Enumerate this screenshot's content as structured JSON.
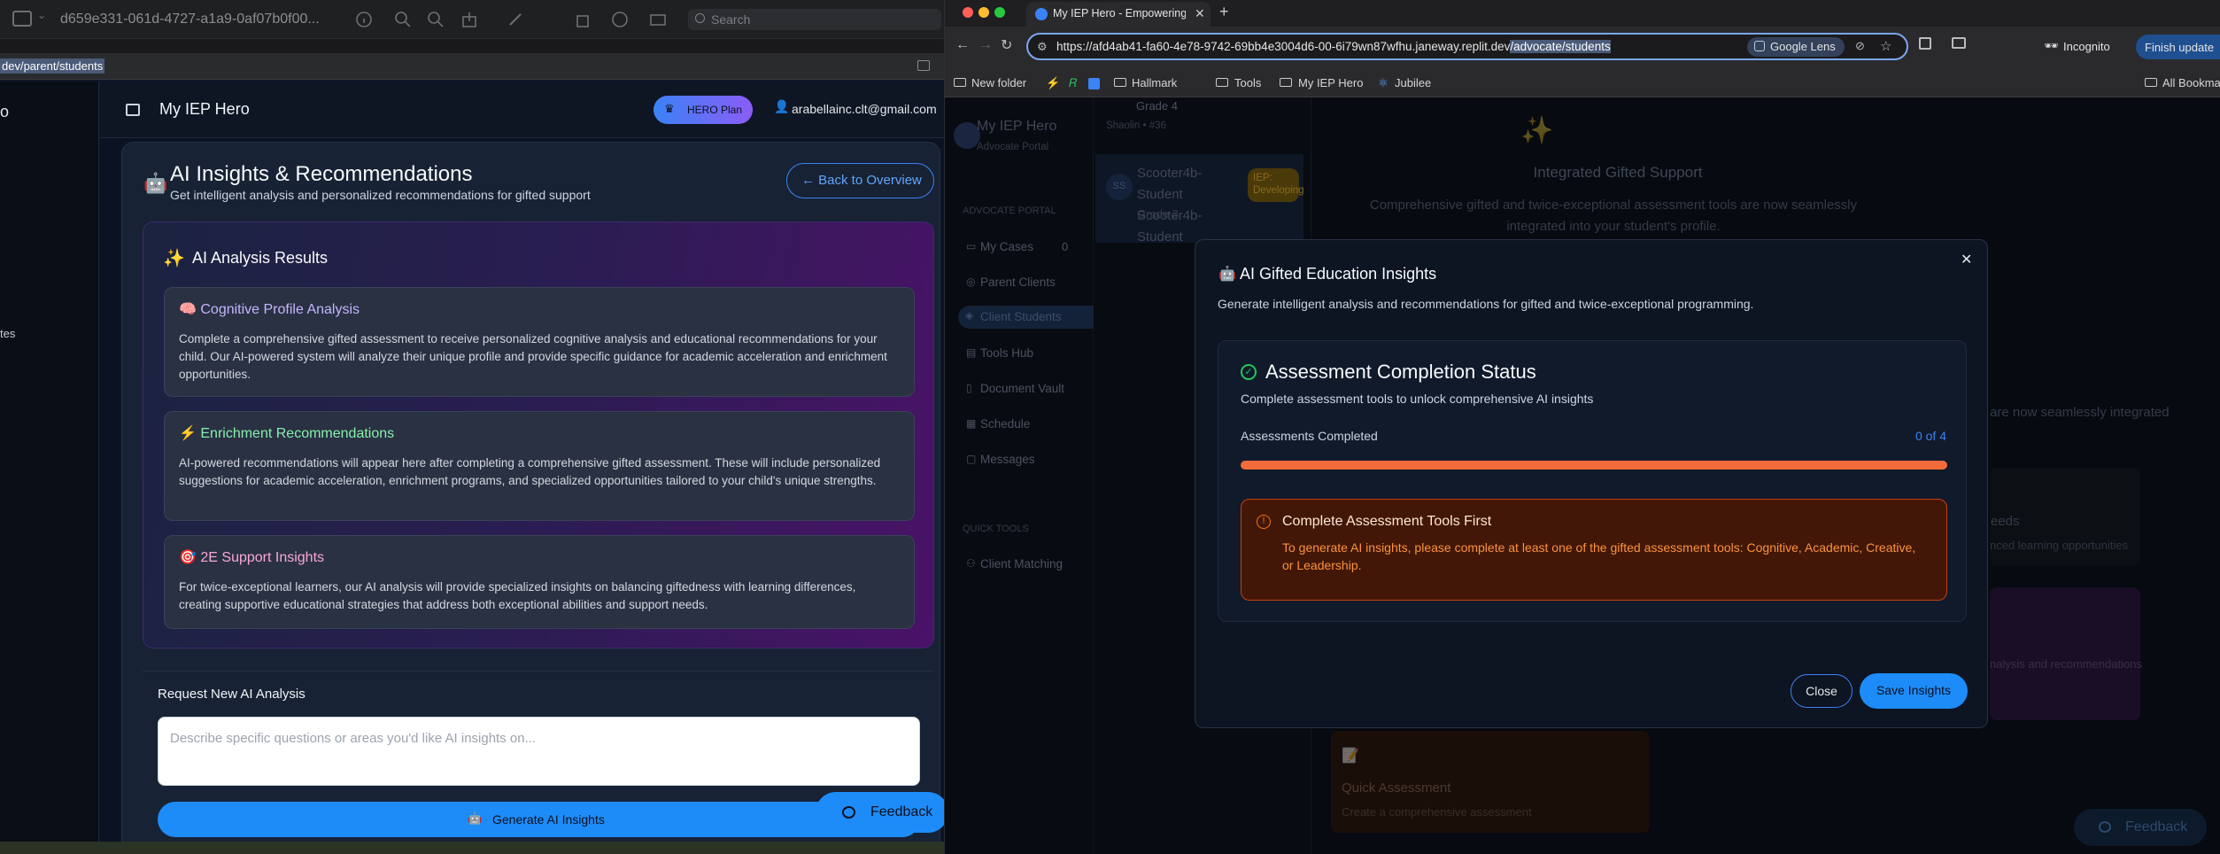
{
  "left_window": {
    "title": "d659e331-061d-4727-a1a9-0af07b0f00...",
    "search_placeholder": "Search",
    "url_selected": "dev/parent/students",
    "sidebar_fragments": [
      "o",
      "tes"
    ]
  },
  "app": {
    "brand": "My IEP Hero",
    "plan": "HERO Plan",
    "user_email": "arabellainc.clt@gmail.com",
    "page_title": "AI Insights & Recommendations",
    "page_subtitle": "Get intelligent analysis and personalized recommendations for gifted support",
    "back_button": "← Back to Overview",
    "results_heading": "AI Analysis Results",
    "results": [
      {
        "emoji": "🧠",
        "title": "Cognitive Profile Analysis",
        "body": "Complete a comprehensive gifted assessment to receive personalized cognitive analysis and educational recommendations for your child. Our AI-powered system will analyze their unique profile and provide specific guidance for academic acceleration and enrichment opportunities.",
        "color": "#c4b5fd"
      },
      {
        "emoji": "⚡",
        "title": "Enrichment Recommendations",
        "body": "AI-powered recommendations will appear here after completing a comprehensive gifted assessment. These will include personalized suggestions for academic acceleration, enrichment programs, and specialized opportunities tailored to your child's unique strengths.",
        "color": "#86efac"
      },
      {
        "emoji": "🎯",
        "title": "2E Support Insights",
        "body": "For twice-exceptional learners, our AI analysis will provide specialized insights on balancing giftedness with learning differences, creating supportive educational strategies that address both exceptional abilities and support needs.",
        "color": "#f9a8d4"
      }
    ],
    "request_heading": "Request New AI Analysis",
    "request_placeholder": "Describe specific questions or areas you'd like AI insights on...",
    "generate_button": "Generate AI Insights",
    "feedback_button": "Feedback"
  },
  "browser": {
    "tab_title": "My IEP Hero - Empowering Pa",
    "url_prefix": "https://afd4ab41-fa60-4e78-9742-69bb4e3004d6-00-6i79wn87wfhu.janeway.replit.dev",
    "url_selected": "/advocate/students",
    "google_lens": "Google Lens",
    "incognito": "Incognito",
    "finish_update": "Finish update",
    "bookmarks": [
      "New folder",
      "Hallmark",
      "Tools",
      "My IEP Hero",
      "Jubilee"
    ],
    "all_bookmarks": "All Bookmarks"
  },
  "portal": {
    "brand": "My IEP Hero",
    "brand_sub": "Advocate Portal",
    "section": "ADVOCATE PORTAL",
    "nav": [
      {
        "label": "My Cases",
        "count": "0"
      },
      {
        "label": "Parent Clients",
        "count": ""
      },
      {
        "label": "Client Students",
        "count": ""
      },
      {
        "label": "Tools Hub",
        "count": ""
      },
      {
        "label": "Document Vault",
        "count": ""
      },
      {
        "label": "Schedule",
        "count": ""
      },
      {
        "label": "Messages",
        "count": ""
      }
    ],
    "quick_tools": "QUICK TOOLS",
    "quick_nav": [
      "Client Matching"
    ],
    "students": [
      {
        "grade": "Grade 4",
        "school": "Shaolin • #36"
      },
      {
        "name": "Scooter4b-Student Scooter4b-Student",
        "grade": "Grade 3",
        "badge": "IEP: Developing",
        "initials": "SS"
      }
    ],
    "bg_panel_icon": "✨",
    "bg_panel_title": "Integrated Gifted Support",
    "bg_panel_text": "Comprehensive gifted and twice-exceptional assessment tools are now seamlessly integrated into your student's profile.",
    "bg_fragment_1": "are now seamlessly integrated",
    "bg_fragment_2": "eeds",
    "bg_fragment_3": "nced learning opportunities",
    "bg_fragment_4": "nalysis and recommendations",
    "quick_assessment_title": "Quick Assessment",
    "quick_assessment_desc": "Create a comprehensive assessment",
    "feedback": "Feedback"
  },
  "modal": {
    "title": "AI Gifted Education Insights",
    "subtitle": "Generate intelligent analysis and recommendations for gifted and twice-exceptional programming.",
    "status_title": "Assessment Completion Status",
    "status_sub": "Complete assessment tools to unlock comprehensive AI insights",
    "progress_label": "Assessments Completed",
    "progress_value": "0 of 4",
    "progress_fraction": 0,
    "warn_title": "Complete Assessment Tools First",
    "warn_body": "To generate AI insights, please complete at least one of the gifted assessment tools: Cognitive, Academic, Creative, or Leadership.",
    "close_button": "Close",
    "save_button": "Save Insights",
    "accent": "#1d8cf8",
    "warn_color": "#f97316"
  }
}
